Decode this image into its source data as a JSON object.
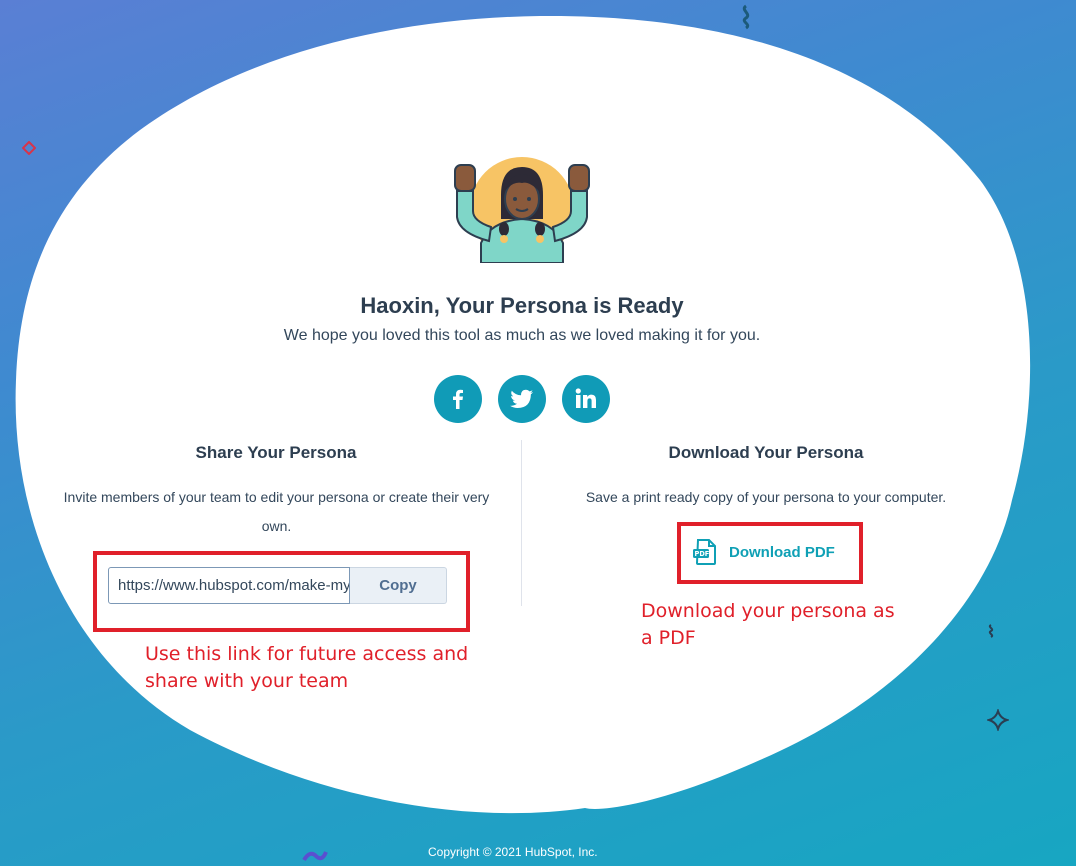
{
  "persona": {
    "title": "Haoxin, Your Persona is Ready",
    "subtitle": "We hope you loved this tool as much as we loved making it for you."
  },
  "social": [
    {
      "name": "facebook",
      "icon": "facebook-icon"
    },
    {
      "name": "twitter",
      "icon": "twitter-icon"
    },
    {
      "name": "linkedin",
      "icon": "linkedin-icon"
    }
  ],
  "share": {
    "heading": "Share Your Persona",
    "description": "Invite members of your team to edit your persona or create their very own.",
    "url_value": "https://www.hubspot.com/make-my-persona",
    "copy_label": "Copy"
  },
  "download": {
    "heading": "Download Your Persona",
    "description": "Save a print ready copy of your persona to your computer.",
    "button_label": "Download PDF",
    "icon": "pdf-file-icon"
  },
  "annotations": {
    "share_note": "Use this link for future access and share with your team",
    "download_note": "Download your persona as a PDF"
  },
  "footer": {
    "copyright": "Copyright © 2021 HubSpot, Inc."
  },
  "colors": {
    "accent": "#109bb7",
    "annotation_red": "#e0202a",
    "heading": "#2d3e50"
  }
}
